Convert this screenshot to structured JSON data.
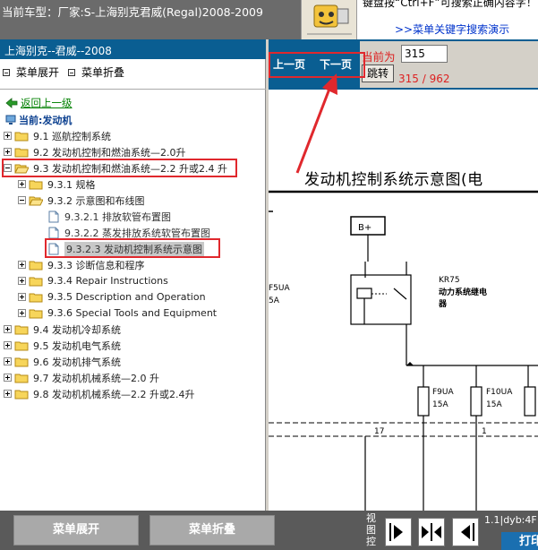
{
  "header": {
    "car_model": "当前车型：厂家:S-上海别克君威(Regal)2008-2009",
    "hint_text": "键盘按“Ctrl+F”可搜索正确内容字！",
    "hint_link": ">>菜单关键字搜索演示"
  },
  "left_panel": {
    "title": "上海别克--君威--2008",
    "expand_all": "菜单展开",
    "collapse_all": "菜单折叠",
    "back": "返回上一级",
    "current": "当前:发动机",
    "tree": [
      {
        "label": "9.1  巡航控制系统"
      },
      {
        "label": "9.2  发动机控制和燃油系统—2.0升"
      },
      {
        "label": "9.3  发动机控制和燃油系统—2.2 升或2.4 升"
      },
      {
        "label": "9.3.1  规格"
      },
      {
        "label": "9.3.2  示意图和布线图"
      },
      {
        "label": "9.3.2.1  排放软管布置图"
      },
      {
        "label": "9.3.2.2  蒸发排放系统软管布置图"
      },
      {
        "label": "9.3.2.3  发动机控制系统示意图"
      },
      {
        "label": "9.3.3  诊断信息和程序"
      },
      {
        "label": "9.3.4  Repair Instructions"
      },
      {
        "label": "9.3.5  Description and Operation"
      },
      {
        "label": "9.3.6  Special Tools and Equipment"
      },
      {
        "label": "9.4  发动机冷却系统"
      },
      {
        "label": "9.5  发动机电气系统"
      },
      {
        "label": "9.6  发动机排气系统"
      },
      {
        "label": "9.7  发动机机械系统—2.0 升"
      },
      {
        "label": "9.8  发动机机械系统—2.2 升或2.4升"
      }
    ]
  },
  "viewer": {
    "prev": "上一页",
    "next": "下一页",
    "current_label": "当前为",
    "page_input": "315",
    "jump": "跳转",
    "page_count": "315 / 962",
    "title": "发动机控制系统示意图(电",
    "diagram": {
      "b_plus": "B+",
      "f5ua": "F5UA",
      "f5ua_amp": "5A",
      "kr75": "KR75",
      "relay_line1": "动力系统继电",
      "relay_line2": "器",
      "f9ua": "F9UA",
      "f9ua_amp": "15A",
      "f10ua": "F10UA",
      "f10ua_amp": "15A",
      "wire_17": "17",
      "wire_1": "1"
    }
  },
  "bottom": {
    "expand": "菜单展开",
    "collapse": "菜单折叠",
    "view_label": "视图控",
    "status": "1.1|dyb:4F",
    "print": "打印"
  },
  "colors": {
    "header_bg": "#6b6b6b",
    "panel_title_bg": "#0a5e92",
    "highlight_red": "#e0282d",
    "bottom_bg": "#5a5a5a"
  }
}
